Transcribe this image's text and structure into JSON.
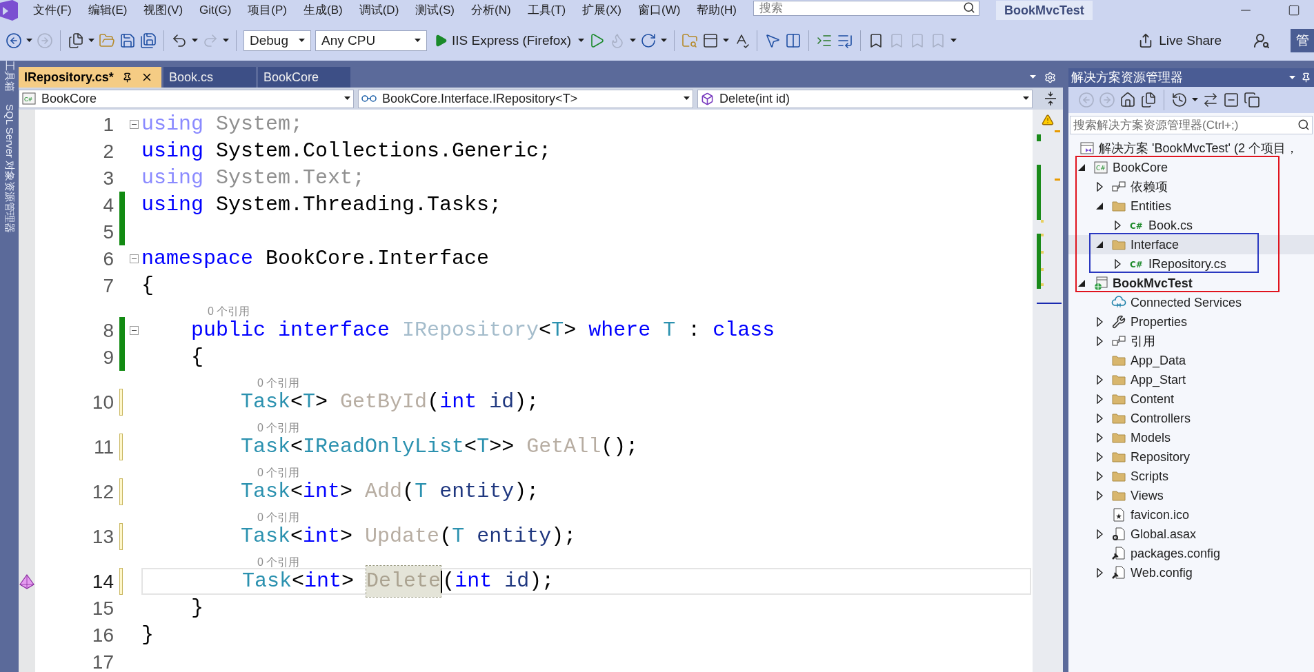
{
  "menu": [
    "文件(F)",
    "编辑(E)",
    "视图(V)",
    "Git(G)",
    "项目(P)",
    "生成(B)",
    "调试(D)",
    "测试(S)",
    "分析(N)",
    "工具(T)",
    "扩展(X)",
    "窗口(W)",
    "帮助(H)"
  ],
  "search": {
    "placeholder": "搜索"
  },
  "window": {
    "title": "BookMvcTest",
    "cut_button": "管"
  },
  "toolbar": {
    "configuration": "Debug",
    "platform": "Any CPU",
    "run_target": "IIS Express (Firefox)",
    "live_share": "Live Share"
  },
  "side_strip": [
    "工具箱",
    "SQL Server 对象资源管理器"
  ],
  "tabs": [
    {
      "label": "IRepository.cs*",
      "selected": true
    },
    {
      "label": "Book.cs",
      "selected": false
    },
    {
      "label": "BookCore",
      "selected": false
    }
  ],
  "navigation": [
    {
      "kind": "project",
      "badge": "C#",
      "label": "BookCore"
    },
    {
      "kind": "type",
      "label": "BookCore.Interface.IRepository<T>"
    },
    {
      "kind": "member",
      "label": "Delete(int id)"
    }
  ],
  "code": [
    {
      "number": "1",
      "collapsed": false,
      "current": false,
      "tokens": [
        {
          "kind": "keyword_dim",
          "text": "using"
        },
        {
          "kind": "plain_dim",
          "text": " System;"
        }
      ]
    },
    {
      "number": "2",
      "current": false,
      "tokens": [
        {
          "kind": "keyword",
          "text": "using"
        },
        {
          "kind": "plain",
          "text": " System.Collections.Generic;"
        }
      ]
    },
    {
      "number": "3",
      "current": false,
      "tokens": [
        {
          "kind": "keyword_dim",
          "text": "using"
        },
        {
          "kind": "plain_dim",
          "text": " System.Text;"
        }
      ]
    },
    {
      "number": "4",
      "saved": true,
      "current": false,
      "tokens": [
        {
          "kind": "keyword",
          "text": "using"
        },
        {
          "kind": "plain",
          "text": " System.Threading.Tasks;"
        }
      ]
    },
    {
      "number": "5",
      "saved": true,
      "current": false
    },
    {
      "number": "6",
      "collapsed": false,
      "current": false,
      "tokens": [
        {
          "kind": "keyword",
          "text": "namespace"
        },
        {
          "kind": "plain",
          "text": " BookCore.Interface"
        }
      ]
    },
    {
      "number": "7",
      "current": false,
      "tokens": [
        {
          "kind": "plain",
          "text": "{"
        }
      ]
    },
    {
      "number": "8",
      "codelens": "0 个引用",
      "collapsed": false,
      "saved": true,
      "current": false,
      "tokens": [
        {
          "kind": "keyword",
          "text": "    public"
        },
        {
          "kind": "keyword",
          "text": " interface"
        },
        {
          "kind": "type_dim",
          "text": " IRepository"
        },
        {
          "kind": "plain",
          "text": "<"
        },
        {
          "kind": "type",
          "text": "T"
        },
        {
          "kind": "plain",
          "text": ">"
        },
        {
          "kind": "keyword",
          "text": " where"
        },
        {
          "kind": "type",
          "text": " T"
        },
        {
          "kind": "plain",
          "text": " :"
        },
        {
          "kind": "keyword",
          "text": " class"
        }
      ]
    },
    {
      "number": "9",
      "saved": true,
      "current": false,
      "tokens": [
        {
          "kind": "plain",
          "text": "    {"
        }
      ]
    },
    {
      "number": "10",
      "codelens": "0 个引用",
      "saved": false,
      "current": false,
      "tokens": [
        {
          "kind": "type",
          "text": "        Task"
        },
        {
          "kind": "plain",
          "text": "<"
        },
        {
          "kind": "type",
          "text": "T"
        },
        {
          "kind": "plain",
          "text": ">"
        },
        {
          "kind": "member_dim",
          "text": " GetById"
        },
        {
          "kind": "plain",
          "text": "("
        },
        {
          "kind": "keyword",
          "text": "int"
        },
        {
          "kind": "parameter",
          "text": " id"
        },
        {
          "kind": "plain",
          "text": ");"
        }
      ]
    },
    {
      "number": "11",
      "codelens": "0 个引用",
      "saved": false,
      "current": false,
      "tokens": [
        {
          "kind": "type",
          "text": "        Task"
        },
        {
          "kind": "plain",
          "text": "<"
        },
        {
          "kind": "type",
          "text": "IReadOnlyList"
        },
        {
          "kind": "plain",
          "text": "<"
        },
        {
          "kind": "type",
          "text": "T"
        },
        {
          "kind": "plain",
          "text": ">>"
        },
        {
          "kind": "member_dim",
          "text": " GetAll"
        },
        {
          "kind": "plain",
          "text": "();"
        }
      ]
    },
    {
      "number": "12",
      "codelens": "0 个引用",
      "saved": false,
      "current": false,
      "tokens": [
        {
          "kind": "type",
          "text": "        Task"
        },
        {
          "kind": "plain",
          "text": "<"
        },
        {
          "kind": "keyword",
          "text": "int"
        },
        {
          "kind": "plain",
          "text": ">"
        },
        {
          "kind": "member_dim",
          "text": " Add"
        },
        {
          "kind": "plain",
          "text": "("
        },
        {
          "kind": "type",
          "text": "T"
        },
        {
          "kind": "parameter",
          "text": " entity"
        },
        {
          "kind": "plain",
          "text": ");"
        }
      ]
    },
    {
      "number": "13",
      "codelens": "0 个引用",
      "saved": false,
      "current": false,
      "tokens": [
        {
          "kind": "type",
          "text": "        Task"
        },
        {
          "kind": "plain",
          "text": "<"
        },
        {
          "kind": "keyword",
          "text": "int"
        },
        {
          "kind": "plain",
          "text": ">"
        },
        {
          "kind": "member_dim",
          "text": " Update"
        },
        {
          "kind": "plain",
          "text": "("
        },
        {
          "kind": "type",
          "text": "T"
        },
        {
          "kind": "parameter",
          "text": " entity"
        },
        {
          "kind": "plain",
          "text": ");"
        }
      ]
    },
    {
      "number": "14",
      "codelens": "0 个引用",
      "saved": false,
      "current": true,
      "quick_action": true,
      "tokens": [
        {
          "kind": "type",
          "text": "        Task"
        },
        {
          "kind": "plain",
          "text": "<"
        },
        {
          "kind": "keyword",
          "text": "int"
        },
        {
          "kind": "plain",
          "text": "> "
        },
        {
          "kind": "match",
          "text": "Delete",
          "caret": true
        },
        {
          "kind": "plain",
          "text": "("
        },
        {
          "kind": "keyword",
          "text": "int"
        },
        {
          "kind": "parameter",
          "text": " id"
        },
        {
          "kind": "plain",
          "text": ");"
        }
      ]
    },
    {
      "number": "15",
      "current": false,
      "tokens": [
        {
          "kind": "plain",
          "text": "    }"
        }
      ]
    },
    {
      "number": "16",
      "current": false,
      "tokens": [
        {
          "kind": "plain",
          "text": "}"
        }
      ]
    },
    {
      "number": "17",
      "current": false
    }
  ],
  "solution_explorer": {
    "title": "解决方案资源管理器",
    "search": {
      "placeholder": "搜索解决方案资源管理器(Ctrl+;)"
    },
    "solution": {
      "label": "解决方案 'BookMvcTest' (2 个项目，"
    },
    "annotations": [
      {
        "kind": "frame",
        "color": "#e0141e"
      },
      {
        "kind": "frame",
        "color": "#2a38c0"
      }
    ],
    "items": [
      {
        "kind": "project",
        "badge": "C#",
        "label": "BookCore",
        "expanded": true,
        "selected": false,
        "in_outer_frame": true,
        "children": [
          {
            "kind": "dependencies",
            "label": "依赖项",
            "expanded": false,
            "selected": false,
            "in_outer_frame": true
          },
          {
            "kind": "folder",
            "label": "Entities",
            "expanded": true,
            "selected": false,
            "in_outer_frame": true,
            "children": [
              {
                "kind": "cs",
                "badge": "C#",
                "label": "Book.cs",
                "expanded": false,
                "selected": false,
                "in_outer_frame": true
              }
            ]
          },
          {
            "kind": "folder",
            "label": "Interface",
            "expanded": true,
            "selected": true,
            "in_outer_frame": true,
            "in_inner_frame": true,
            "children": [
              {
                "kind": "cs",
                "badge": "C#",
                "label": "IRepository.cs",
                "expanded": false,
                "selected": false,
                "in_outer_frame": true,
                "in_inner_frame": true
              }
            ]
          }
        ]
      },
      {
        "kind": "startup_project",
        "label": "BookMvcTest",
        "expanded": true,
        "selected": false,
        "in_outer_frame": true,
        "children": [
          {
            "kind": "connected",
            "label": "Connected Services",
            "selected": false
          },
          {
            "kind": "properties",
            "label": "Properties",
            "expanded": false,
            "selected": false
          },
          {
            "kind": "references",
            "label": "引用",
            "expanded": false,
            "selected": false
          },
          {
            "kind": "folder",
            "label": "App_Data",
            "selected": false
          },
          {
            "kind": "folder",
            "label": "App_Start",
            "expanded": false,
            "selected": false
          },
          {
            "kind": "folder",
            "label": "Content",
            "expanded": false,
            "selected": false
          },
          {
            "kind": "folder",
            "label": "Controllers",
            "expanded": false,
            "selected": false
          },
          {
            "kind": "folder",
            "label": "Models",
            "expanded": false,
            "selected": false
          },
          {
            "kind": "folder",
            "label": "Repository",
            "expanded": false,
            "selected": false
          },
          {
            "kind": "folder",
            "label": "Scripts",
            "expanded": false,
            "selected": false
          },
          {
            "kind": "folder",
            "label": "Views",
            "expanded": false,
            "selected": false
          },
          {
            "kind": "ico",
            "label": "favicon.ico",
            "selected": false
          },
          {
            "kind": "asax",
            "label": "Global.asax",
            "expanded": false,
            "selected": false
          },
          {
            "kind": "config",
            "label": "packages.config",
            "selected": false
          },
          {
            "kind": "config",
            "label": "Web.config",
            "expanded": false,
            "selected": false
          }
        ]
      }
    ]
  }
}
